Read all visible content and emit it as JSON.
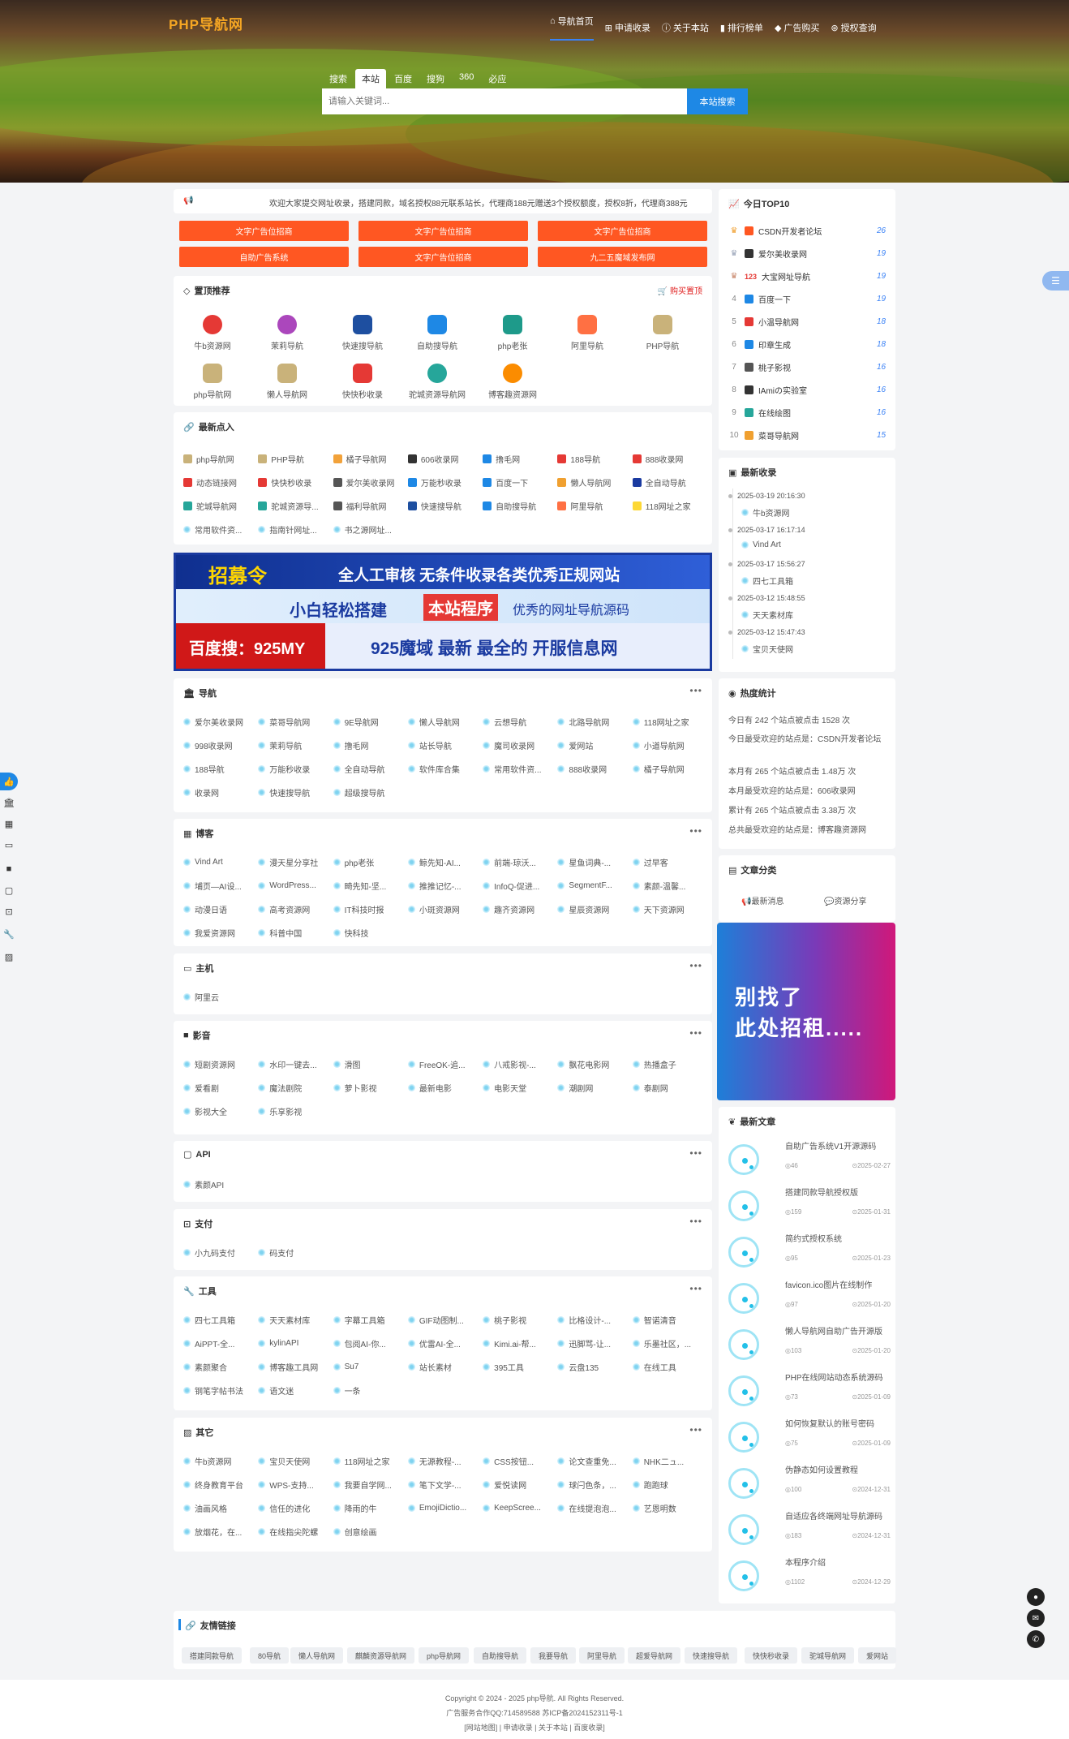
{
  "header": {
    "logo": "PHP导航网",
    "nav": [
      "导航首页",
      "申请收录",
      "关于本站",
      "排行榜单",
      "广告购买",
      "授权查询"
    ]
  },
  "search": {
    "tabs": [
      "搜索",
      "本站",
      "百度",
      "搜狗",
      "360",
      "必应"
    ],
    "placeholder": "请输入关键词...",
    "button": "本站搜索"
  },
  "notice": "欢迎大家提交网址收录，搭建同款，域名授权88元联系站长，代理商188元赠送3个授权额度，授权8折，代理商388元",
  "ads": [
    "文字广告位招商",
    "文字广告位招商",
    "文字广告位招商",
    "自助广告系统",
    "文字广告位招商",
    "九二五魔域发布网"
  ],
  "pinned": {
    "title": "置顶推荐",
    "buy": "购买置顶",
    "items": [
      "牛b资源网",
      "茉莉导航",
      "快速搜导航",
      "自助搜导航",
      "php老张",
      "阿里导航",
      "PHP导航",
      "php导航网",
      "懒人导航网",
      "快快秒收录",
      "驼城资源导航网",
      "博客趣资源网"
    ]
  },
  "latest": {
    "title": "最新点入",
    "items": [
      "php导航网",
      "PHP导航",
      "橘子导航网",
      "606收录网",
      "撸毛网",
      "188导航",
      "888收录网",
      "动态链接网",
      "快快秒收录",
      "爱尔美收录网",
      "万能秒收录",
      "百度一下",
      "懒人导航网",
      "全自动导航",
      "驼城导航网",
      "驼城资源导...",
      "福利导航网",
      "快速搜导航",
      "自助搜导航",
      "阿里导航",
      "118网址之家",
      "常用软件资...",
      "指南针网址...",
      "书之源网址..."
    ]
  },
  "banner": {
    "l1a": "招募令",
    "l1b": "全人工审核  无条件收录各类优秀正规网站",
    "l2a": "小白轻松搭建",
    "l2b": "本站程序",
    "l2c": "优秀的网址导航源码",
    "l3a": "百度搜：925MY",
    "l3b": "925魔域 最新 最全的 开服信息网"
  },
  "cats": [
    {
      "title": "导航",
      "items": [
        "爱尔美收录网",
        "菜哥导航网",
        "9E导航网",
        "懒人导航网",
        "云想导航",
        "北路导航网",
        "118网址之家",
        "998收录网",
        "茉莉导航",
        "撸毛网",
        "站长导航",
        "魔司收录网",
        "爱网站",
        "小道导航网",
        "188导航",
        "万能秒收录",
        "全自动导航",
        "软件库合集",
        "常用软件资...",
        "888收录网",
        "橘子导航网",
        "收录网",
        "快速搜导航",
        "超级搜导航"
      ]
    },
    {
      "title": "博客",
      "items": [
        "Vind Art",
        "漫天星分享社",
        "php老张",
        "鲸先知-AI...",
        "前端-琼沃...",
        "星鱼词典-...",
        "过早客",
        "埔页—AI设...",
        "WordPress...",
        "畸先知-坚...",
        "推推记忆-...",
        "InfoQ-促进...",
        "SegmentF...",
        "素颜-温馨...",
        "动漫日语",
        "高考资源网",
        "IT科技时报",
        "小斑资源网",
        "趣齐资源网",
        "星辰资源网",
        "天下资源网",
        "我爱资源网",
        "科普中国",
        "快科技"
      ]
    },
    {
      "title": "主机",
      "items": [
        "阿里云"
      ]
    },
    {
      "title": "影音",
      "items": [
        "短剧资源网",
        "水印一键去...",
        "滑图",
        "FreeOK-追...",
        "八戒影视-...",
        "飘花电影网",
        "热播盒子",
        "爱看剧",
        "魔法剧院",
        "萝卜影视",
        "最新电影",
        "电影天堂",
        "潮剧网",
        "泰剧网",
        "影视大全",
        "乐享影视"
      ]
    },
    {
      "title": "API",
      "items": [
        "素颜API"
      ]
    },
    {
      "title": "支付",
      "items": [
        "小九码支付",
        "码支付"
      ]
    },
    {
      "title": "工具",
      "items": [
        "四七工具箱",
        "天天素材库",
        "字幕工具箱",
        "GIF动图制...",
        "桃子影视",
        "比格设计-...",
        "智诺清音",
        "AiPPT-全...",
        "kylinAPI",
        "包阅AI-你...",
        "优雷AI-全...",
        "Kimi.ai-帮...",
        "迅脚骂-让...",
        "乐墨社区，...",
        "素颜聚合",
        "博客趣工具网",
        "Su7",
        "站长素材",
        "395工具",
        "云盘135",
        "在线工具",
        "钢笔字帖书法",
        "语文迷",
        "一条"
      ]
    },
    {
      "title": "其它",
      "items": [
        "牛b资源网",
        "宝贝天使网",
        "118网址之家",
        "无源教程-...",
        "CSS按钮...",
        "论文查重免...",
        "NHK二ュ...",
        "终身教育平台",
        "WPS-支持...",
        "我要自学网...",
        "笔下文学-...",
        "爱悦读网",
        "球闩色条，...",
        "跑跑球",
        "油画风格",
        "信任的进化",
        "降雨的牛",
        "EmojiDictio...",
        "KeepScree...",
        "在线提泡泡...",
        "艺恩明数",
        "放烟花，在...",
        "在线指尖陀螺",
        "创意绘画"
      ]
    }
  ],
  "top10": {
    "title": "今日TOP10",
    "items": [
      {
        "name": "CSDN开发者论坛",
        "count": "26"
      },
      {
        "name": "爱尔美收录网",
        "count": "19"
      },
      {
        "name": "大宝网址导航",
        "count": "19"
      },
      {
        "name": "百度一下",
        "count": "19"
      },
      {
        "name": "小温导航网",
        "count": "18"
      },
      {
        "name": "印章生成",
        "count": "18"
      },
      {
        "name": "桃子影视",
        "count": "16"
      },
      {
        "name": "IAmiの实验室",
        "count": "16"
      },
      {
        "name": "在线绘图",
        "count": "16"
      },
      {
        "name": "菜哥导航网",
        "count": "15"
      }
    ],
    "badge": "123"
  },
  "recent": {
    "title": "最新收录",
    "items": [
      {
        "time": "2025-03-19 20:16:30",
        "name": "牛b资源网"
      },
      {
        "time": "2025-03-17 16:17:14",
        "name": "Vind Art"
      },
      {
        "time": "2025-03-17 15:56:27",
        "name": "四七工具箱"
      },
      {
        "time": "2025-03-12 15:48:55",
        "name": "天天素材库"
      },
      {
        "time": "2025-03-12 15:47:43",
        "name": "宝贝天使网"
      }
    ]
  },
  "stats": {
    "title": "热度统计",
    "lines": [
      "今日有 242 个站点被点击 1528 次",
      "今日最受欢迎的站点是：CSDN开发者论坛",
      "本月有 265 个站点被点击 1.48万 次",
      "本月最受欢迎的站点是：606收录网",
      "累计有 265 个站点被点击 3.38万 次",
      "总共最受欢迎的站点是：博客趣资源网"
    ]
  },
  "article_cat": {
    "title": "文章分类",
    "items": [
      "最新消息",
      "资源分享"
    ]
  },
  "promo": {
    "l1": "别找了",
    "l2": "此处招租....."
  },
  "articles": {
    "title": "最新文章",
    "items": [
      {
        "t": "自助广告系统V1开源源码",
        "v": "46",
        "d": "2025-02-27"
      },
      {
        "t": "搭建同款导航授权版",
        "v": "159",
        "d": "2025-01-31"
      },
      {
        "t": "简约式授权系统",
        "v": "95",
        "d": "2025-01-23"
      },
      {
        "t": "favicon.ico图片在线制作",
        "v": "97",
        "d": "2025-01-20"
      },
      {
        "t": "懒人导航网自助广告开源版",
        "v": "103",
        "d": "2025-01-20"
      },
      {
        "t": "PHP在线网站动态系统源码",
        "v": "73",
        "d": "2025-01-09"
      },
      {
        "t": "如何恢复默认的账号密码",
        "v": "75",
        "d": "2025-01-09"
      },
      {
        "t": "伪静态如何设置教程",
        "v": "100",
        "d": "2024-12-31"
      },
      {
        "t": "自适应各终端网址导航源码",
        "v": "183",
        "d": "2024-12-31"
      },
      {
        "t": "本程序介绍",
        "v": "1102",
        "d": "2024-12-29"
      }
    ]
  },
  "friends": {
    "title": "友情链接",
    "items": [
      "搭建同款导航",
      "80导航",
      "懒人导航网",
      "麒麟资源导航网",
      "php导航网",
      "自助搜导航",
      "我要导航",
      "阿里导航",
      "超爱导航网",
      "快速搜导航",
      "快快秒收录",
      "驼城导航网",
      "爱网站"
    ]
  },
  "footer": {
    "l1": "Copyright © 2024 - 2025 php导航. All Rights Reserved.",
    "l2": "广告服务合作QQ:714589588 苏ICP备2024152311号-1",
    "l3": "[网站地图] | 申请收录 | 关于本站 | 百度收录]"
  },
  "colors": {
    "accent": "#ff5722",
    "blue": "#1e88e5"
  }
}
